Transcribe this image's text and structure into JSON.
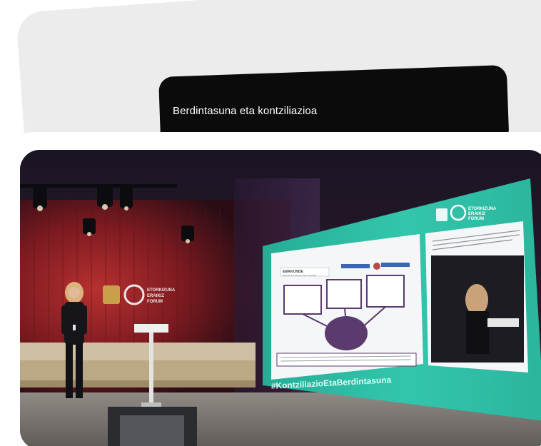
{
  "caption": {
    "title": "Berdintasuna eta kontziliazioa"
  },
  "photo": {
    "left_wall_logo_lines": [
      "ETORKIZUNA",
      "ERAIKIZ",
      "FORUM"
    ],
    "screen_logo_lines": [
      "ETORKIZUNA",
      "ERAIKIZ",
      "FORUM"
    ],
    "screen_hashtag": "#KontziliazioEtaBerdintasuna",
    "slide_logo_lines": [
      "EMAKUNDE",
      "INSTITUTO VASCO DE LA MUJER"
    ],
    "colors": {
      "screen_teal": "#2fc1a6",
      "stage_red": "#8c1e22",
      "caption_bg": "#0b0b0b",
      "card_grey": "#ececec",
      "slide_purple": "#5b3a6e"
    }
  }
}
